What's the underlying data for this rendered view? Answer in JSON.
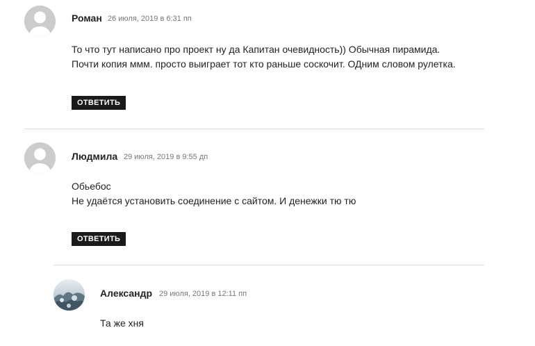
{
  "comments": [
    {
      "author": "Роман",
      "date": "26 июля, 2019 в 6:31 пп",
      "lines": [
        "То что тут написано про проект ну да Капитан очевидность)) Обычная пирамида.",
        "Почти копия ммм. просто выиграет тот кто раньше соскочит. ОДним словом рулетка."
      ],
      "reply_label": "ОТВЕТИТЬ"
    },
    {
      "author": "Людмила",
      "date": "29 июля, 2019 в 9:55 дп",
      "lines": [
        "Обьебос",
        "Не удаётся установить соединение с сайтом. И денежки тю тю"
      ],
      "reply_label": "ОТВЕТИТЬ"
    },
    {
      "author": "Александр",
      "date": "29 июля, 2019 в 12:11 пп",
      "lines": [
        "Та же хня"
      ]
    }
  ]
}
